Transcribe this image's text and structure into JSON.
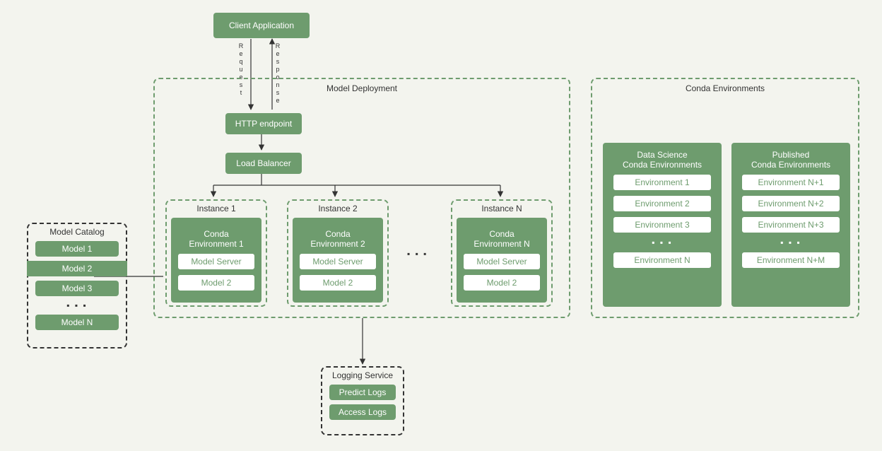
{
  "client_app": "Client Application",
  "request_label": "Request",
  "response_label": "Response",
  "model_deployment": {
    "title": "Model Deployment",
    "http_endpoint": "HTTP endpoint",
    "load_balancer": "Load Balancer",
    "instances": [
      {
        "title": "Instance 1",
        "env": "Conda\nEnvironment 1",
        "server": "Model Server",
        "model": "Model 2"
      },
      {
        "title": "Instance 2",
        "env": "Conda\nEnvironment 2",
        "server": "Model Server",
        "model": "Model 2"
      },
      {
        "title": "Instance N",
        "env": "Conda\nEnvironment N",
        "server": "Model Server",
        "model": "Model 2"
      }
    ]
  },
  "model_catalog": {
    "title": "Model Catalog",
    "items": [
      "Model 1",
      "Model 2",
      "Model 3",
      "Model N"
    ]
  },
  "logging_service": {
    "title": "Logging Service",
    "items": [
      "Predict Logs",
      "Access Logs"
    ]
  },
  "conda_environments": {
    "title": "Conda Environments",
    "groups": [
      {
        "title": "Data Science\nConda Environments",
        "items": [
          "Environment 1",
          "Environment 2",
          "Environment 3",
          "Environment N"
        ]
      },
      {
        "title": "Published\nConda Environments",
        "items": [
          "Environment N+1",
          "Environment N+2",
          "Environment N+3",
          "Environment N+M"
        ]
      }
    ]
  },
  "ellipsis": "▪ ▪ ▪"
}
